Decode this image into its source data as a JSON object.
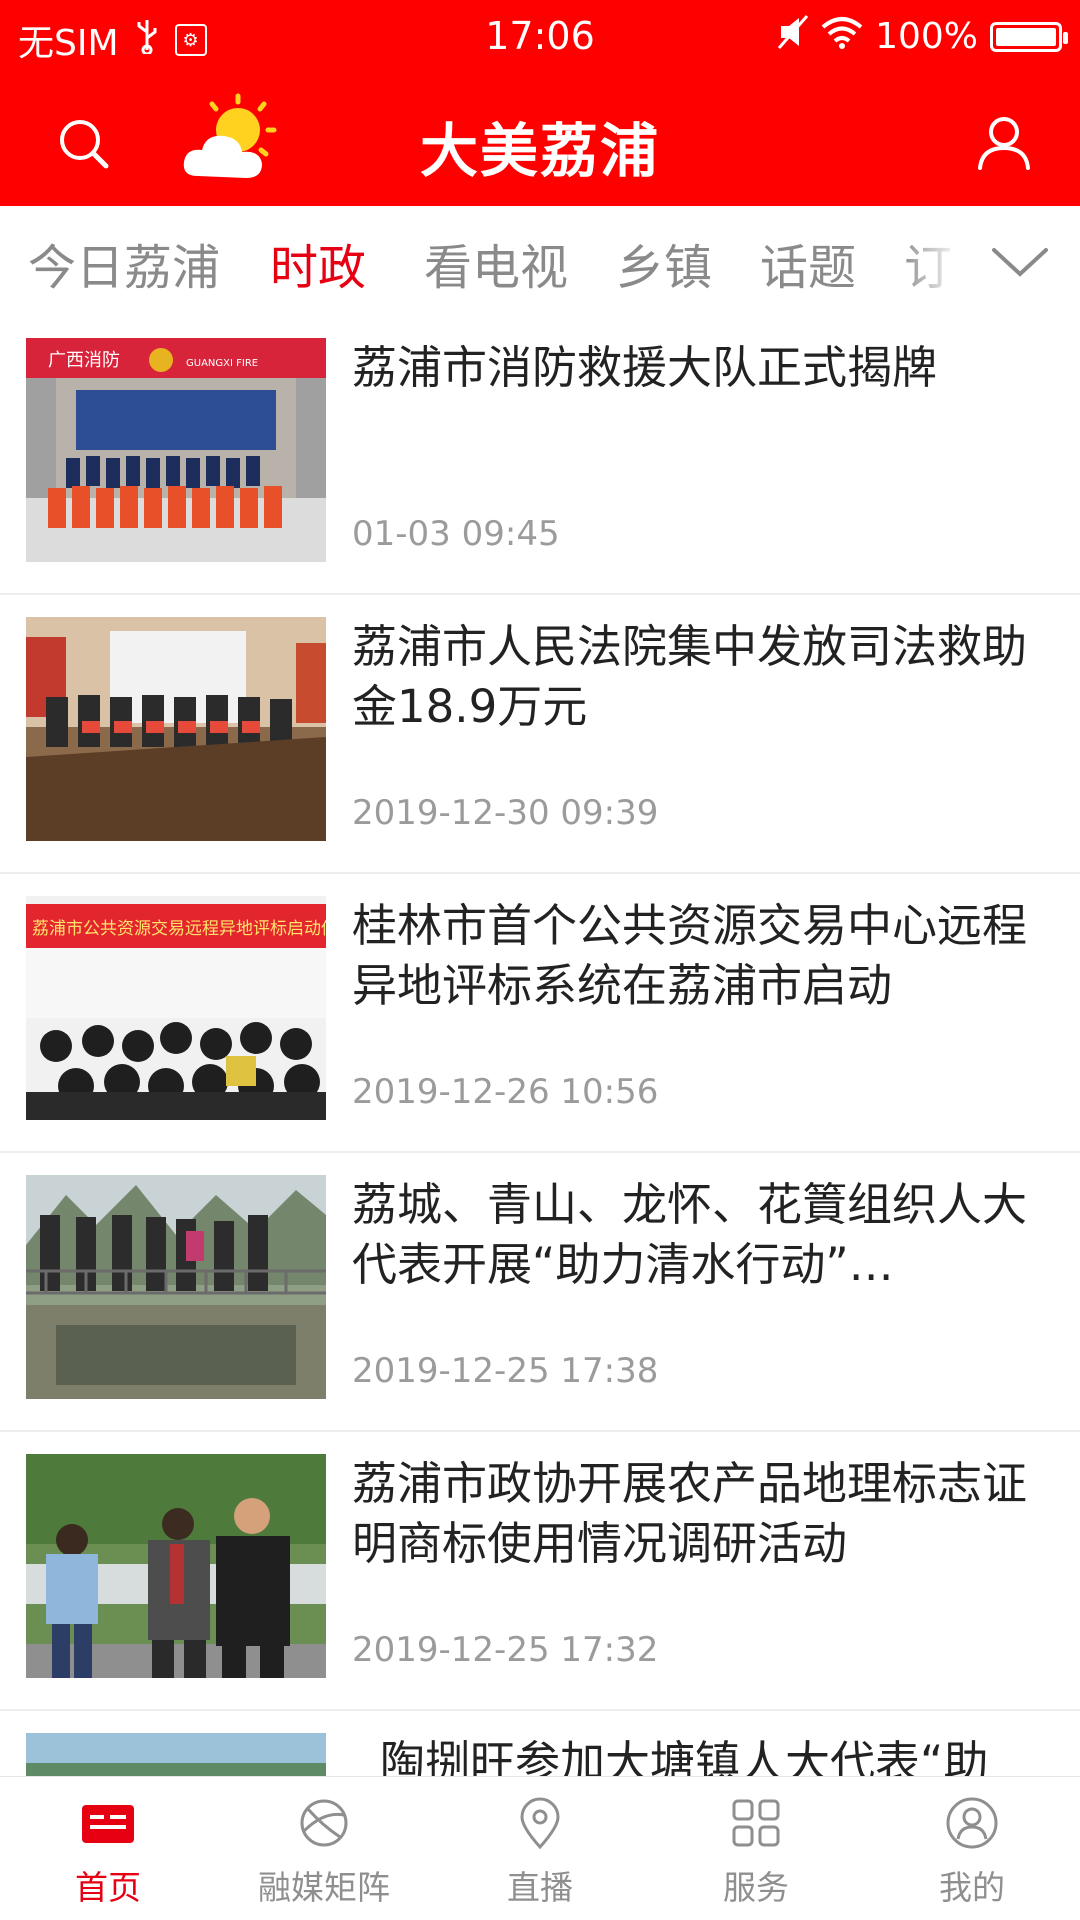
{
  "status_bar": {
    "carrier": "无SIM",
    "time": "17:06",
    "battery": "100%",
    "battery_level": 1.0
  },
  "header": {
    "title": "大美荔浦",
    "icons": [
      "search-icon",
      "weather-partly-cloudy-icon",
      "user-icon"
    ],
    "color": "#ff0000"
  },
  "tabs": {
    "items": [
      "今日荔浦",
      "时政",
      "看电视",
      "乡镇",
      "话题",
      "订"
    ],
    "active": "时政",
    "more_icon": "chevron-down-icon",
    "active_color": "#e60012"
  },
  "feed": [
    {
      "title": "荔浦市消防救援大队正式揭牌",
      "date": "01-03 09:45"
    },
    {
      "title": "荔浦市人民法院集中发放司法救助金18.9万元",
      "date": "2019-12-30 09:39"
    },
    {
      "title": "桂林市首个公共资源交易中心远程异地评标系统在荔浦市启动",
      "date": "2019-12-26 10:56"
    },
    {
      "title": "荔城、青山、龙怀、花篢组织人大代表开展“助力清水行动”…",
      "date": "2019-12-25 17:38"
    },
    {
      "title": "荔浦市政协开展农产品地理标志证明商标使用情况调研活动",
      "date": "2019-12-25 17:32"
    },
    {
      "title": "陶捌旺参加大塘镇人大代表“助",
      "date": ""
    }
  ],
  "thumb_text": {
    "fire_sign": "广西消防",
    "fire_sign_en": "GUANGXI FIRE",
    "banner": "荔浦市公共资源交易远程异地评标启动仪式"
  },
  "bottom_nav": {
    "items": [
      {
        "label": "首页",
        "icon": "home-news-icon"
      },
      {
        "label": "融媒矩阵",
        "icon": "globe-icon"
      },
      {
        "label": "直播",
        "icon": "location-pin-icon"
      },
      {
        "label": "服务",
        "icon": "grid-icon"
      },
      {
        "label": "我的",
        "icon": "profile-icon"
      }
    ],
    "active": "首页"
  }
}
